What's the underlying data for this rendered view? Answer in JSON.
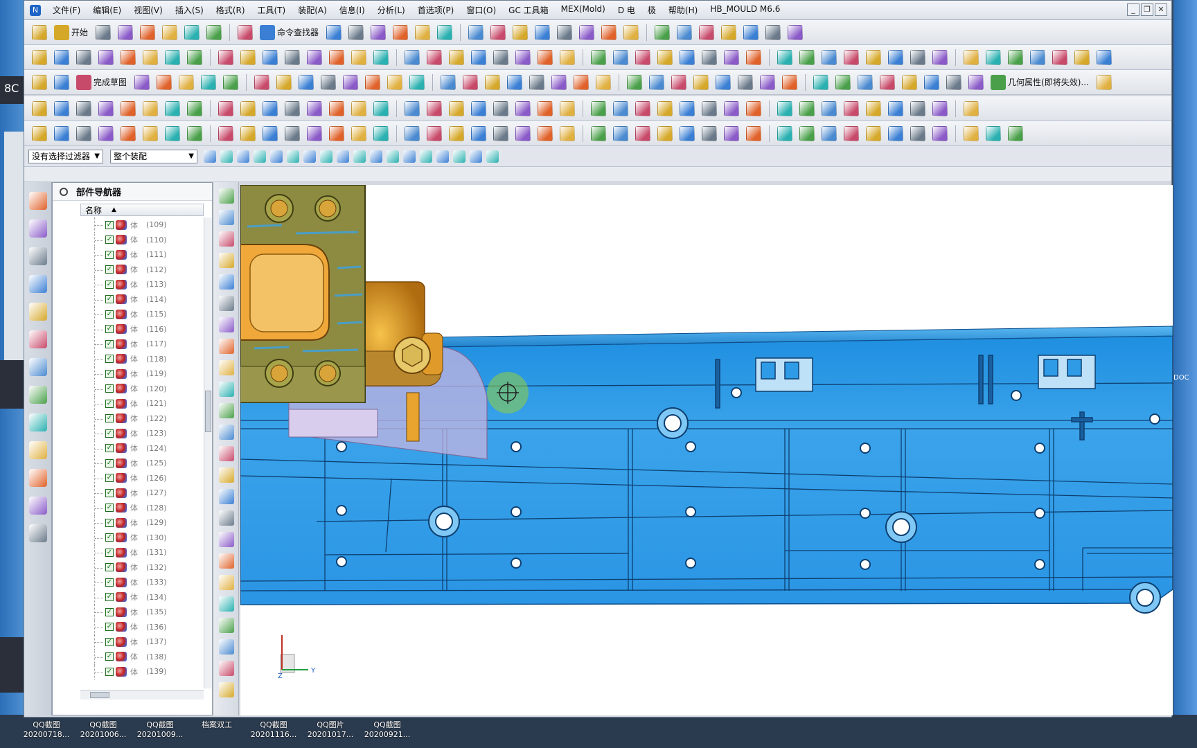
{
  "app": {
    "title_icon": "nx-logo",
    "menu": [
      "文件(F)",
      "编辑(E)",
      "视图(V)",
      "插入(S)",
      "格式(R)",
      "工具(T)",
      "装配(A)",
      "信息(I)",
      "分析(L)",
      "首选项(P)",
      "窗口(O)",
      "GC 工具箱",
      "MEX(Mold)",
      "D 电",
      "极",
      "帮助(H)",
      "HB_MOULD M6.6"
    ],
    "window_buttons": [
      "_",
      "❐",
      "✕"
    ]
  },
  "toolbar": {
    "start_label": "开始",
    "command_finder_label": "命令查找器",
    "finish_sketch_label": "完成草图",
    "geometry_props_label": "几何属性(即将失效)..."
  },
  "filters": {
    "selection_filter": "没有选择过滤器",
    "assembly_scope": "整个装配"
  },
  "navigator": {
    "title": "部件导航器",
    "column_name": "名称",
    "rows": [
      {
        "name": "体",
        "id": "(109)"
      },
      {
        "name": "体",
        "id": "(110)"
      },
      {
        "name": "体",
        "id": "(111)"
      },
      {
        "name": "体",
        "id": "(112)"
      },
      {
        "name": "体",
        "id": "(113)"
      },
      {
        "name": "体",
        "id": "(114)"
      },
      {
        "name": "体",
        "id": "(115)"
      },
      {
        "name": "体",
        "id": "(116)"
      },
      {
        "name": "体",
        "id": "(117)"
      },
      {
        "name": "体",
        "id": "(118)"
      },
      {
        "name": "体",
        "id": "(119)"
      },
      {
        "name": "体",
        "id": "(120)"
      },
      {
        "name": "体",
        "id": "(121)"
      },
      {
        "name": "体",
        "id": "(122)"
      },
      {
        "name": "体",
        "id": "(123)"
      },
      {
        "name": "体",
        "id": "(124)"
      },
      {
        "name": "体",
        "id": "(125)"
      },
      {
        "name": "体",
        "id": "(126)"
      },
      {
        "name": "体",
        "id": "(127)"
      },
      {
        "name": "体",
        "id": "(128)"
      },
      {
        "name": "体",
        "id": "(129)"
      },
      {
        "name": "体",
        "id": "(130)"
      },
      {
        "name": "体",
        "id": "(131)"
      },
      {
        "name": "体",
        "id": "(132)"
      },
      {
        "name": "体",
        "id": "(133)"
      },
      {
        "name": "体",
        "id": "(134)"
      },
      {
        "name": "体",
        "id": "(135)"
      },
      {
        "name": "体",
        "id": "(136)"
      },
      {
        "name": "体",
        "id": "(137)"
      },
      {
        "name": "体",
        "id": "(138)"
      },
      {
        "name": "体",
        "id": "(139)"
      }
    ]
  },
  "viewport": {
    "axis_y": "Y",
    "axis_z": "Z",
    "colors": {
      "plate": "#2f9be6",
      "plate_dark": "#1c6fb5",
      "block": "#8a8a3c",
      "cylinder": "#e69a1c",
      "transparent": "#b9a6d6"
    }
  },
  "desktop": {
    "icons": [
      {
        "name": "QQ截图",
        "date": "20200718..."
      },
      {
        "name": "QQ截图",
        "date": "20201006..."
      },
      {
        "name": "QQ截图",
        "date": "20201009..."
      },
      {
        "name": "档案双工",
        "date": ""
      },
      {
        "name": "QQ截图",
        "date": "20201116..."
      },
      {
        "name": "QQ图片",
        "date": "20201017..."
      },
      {
        "name": "QQ截图",
        "date": "20200921..."
      }
    ],
    "right_label": "DOC"
  }
}
